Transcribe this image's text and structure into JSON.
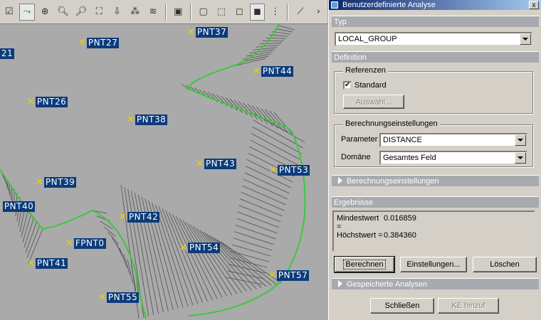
{
  "toolbar": {
    "icons": [
      "check-box-icon",
      "curve-analysis-icon",
      "zoom-window-icon",
      "zoom-in-icon",
      "zoom-out-icon",
      "zoom-fit-icon",
      "datum-point-icon",
      "datum-axis-icon",
      "layers-icon",
      "saved-views-icon",
      "wireframe-icon",
      "hidden-line-icon",
      "no-hidden-icon",
      "shading-icon",
      "datum-display-icon",
      "sketch-icon",
      "more-icon"
    ]
  },
  "points": [
    {
      "label": "PNT37"
    },
    {
      "label": "PNT27"
    },
    {
      "label": "21"
    },
    {
      "label": "PNT44"
    },
    {
      "label": "PNT26"
    },
    {
      "label": "PNT38"
    },
    {
      "label": "PNT43"
    },
    {
      "label": "PNT53"
    },
    {
      "label": "PNT39"
    },
    {
      "label": "PNT40"
    },
    {
      "label": "PNT42"
    },
    {
      "label": "FPNT0"
    },
    {
      "label": "PNT54"
    },
    {
      "label": "PNT41"
    },
    {
      "label": "PNT57"
    },
    {
      "label": "PNT55"
    }
  ],
  "dialog": {
    "title": "Benutzerdefinierte Analyse",
    "close_label": "x",
    "typ_header": "Typ",
    "typ_value": "LOCAL_GROUP",
    "definition_header": "Definition",
    "referenzen_title": "Referenzen",
    "standard_label": "Standard",
    "standard_checked": true,
    "auswahl_label": "Auswahl...",
    "berech_group_title": "Berechnungseinstellungen",
    "parameter_label": "Parameter",
    "parameter_value": "DISTANCE",
    "domaene_label": "Domäne",
    "domaene_value": "Gesamtes Feld",
    "berech_section": "Berechnungseinstellungen",
    "ergebnisse_header": "Ergebnisse",
    "results": [
      {
        "key": "Mindestwert =",
        "value": "0.016859"
      },
      {
        "key": "Höchstwert =",
        "value": "0.384360"
      }
    ],
    "berechnen_label": "Berechnen",
    "einstellungen_label": "Einstellungen...",
    "loeschen_label": "Löschen",
    "gespeicherte_section": "Gespeicherte Analysen",
    "schliessen_label": "Schließen",
    "ke_hinzu_label": "KE hinzuf"
  },
  "colors": {
    "label_bg": "#0c3b7a",
    "point_mark": "#e6d200",
    "boundary": "#3cc83c",
    "titlebar": "#0a246a"
  }
}
